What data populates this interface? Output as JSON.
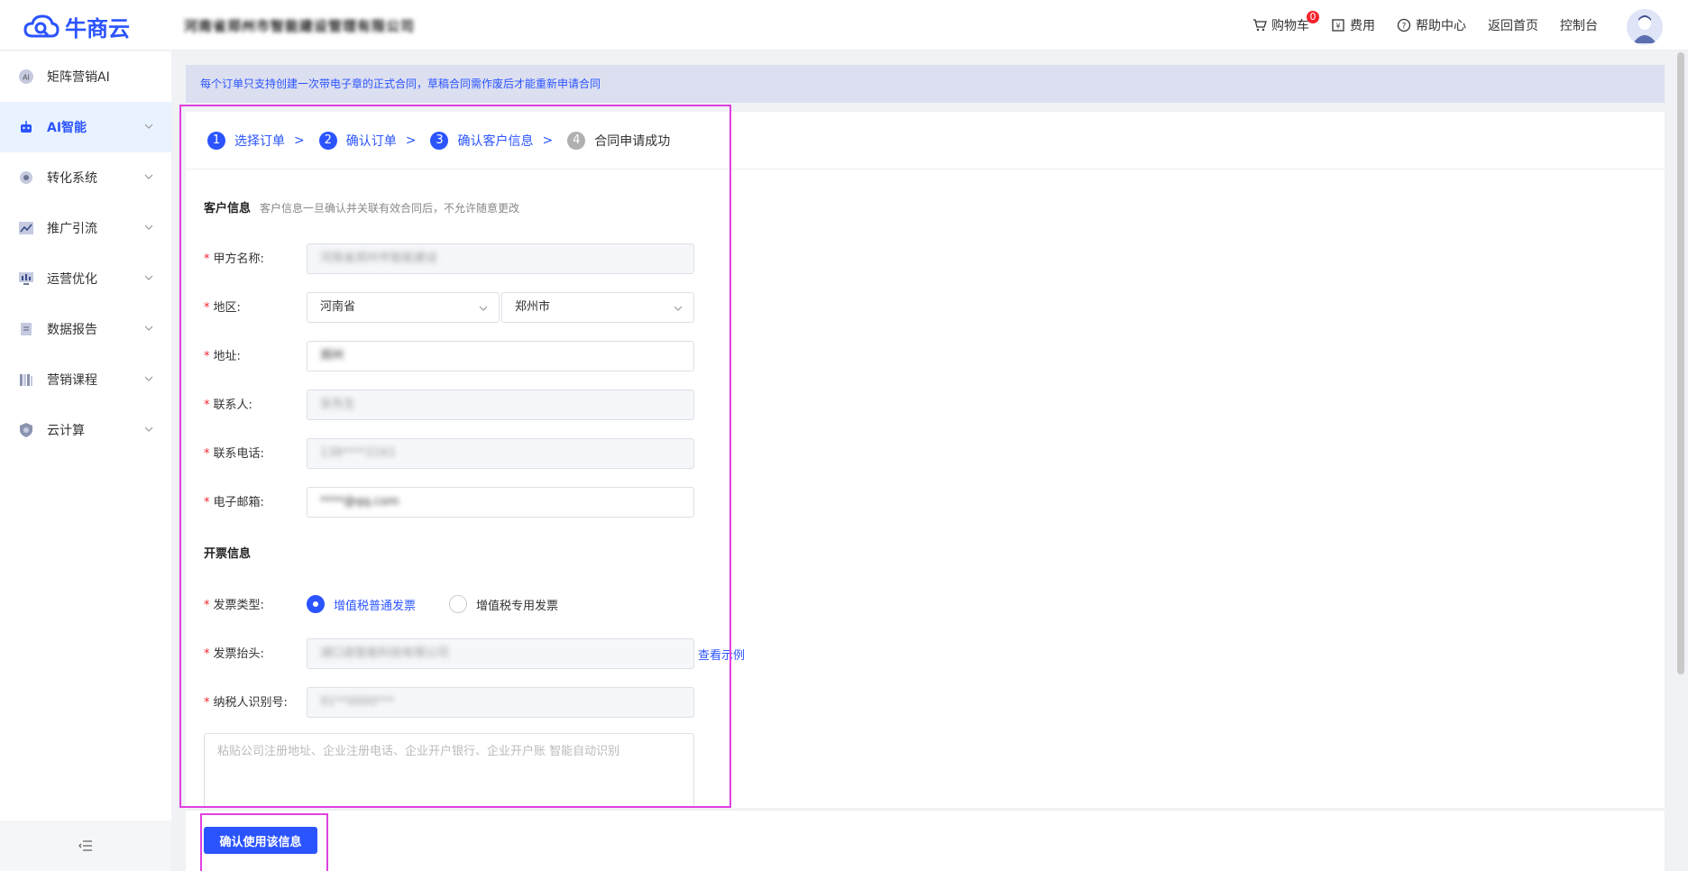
{
  "header": {
    "logo_text": "牛商云",
    "company_name": "河南省郑州市智能建设管理有限公司",
    "nav": {
      "cart": "购物车",
      "cart_count": "0",
      "fees": "费用",
      "help": "帮助中心",
      "home": "返回首页",
      "console": "控制台"
    }
  },
  "sidebar": {
    "items": [
      {
        "label": "矩阵营销AI",
        "icon": "ai-badge-icon"
      },
      {
        "label": "AI智能",
        "icon": "robot-icon"
      },
      {
        "label": "转化系统",
        "icon": "gear-icon"
      },
      {
        "label": "推广引流",
        "icon": "trend-icon"
      },
      {
        "label": "运营优化",
        "icon": "monitor-icon"
      },
      {
        "label": "数据报告",
        "icon": "report-icon"
      },
      {
        "label": "营销课程",
        "icon": "books-icon"
      },
      {
        "label": "云计算",
        "icon": "shield-icon"
      }
    ]
  },
  "notice": "每个订单只支持创建一次带电子章的正式合同，草稿合同需作废后才能重新申请合同",
  "steps": [
    {
      "num": "1",
      "label": "选择订单"
    },
    {
      "num": "2",
      "label": "确认订单"
    },
    {
      "num": "3",
      "label": "确认客户信息"
    },
    {
      "num": "4",
      "label": "合同申请成功"
    }
  ],
  "step_separator": ">",
  "customer": {
    "title": "客户信息",
    "hint": "客户信息一旦确认并关联有效合同后，不允许随意更改",
    "fields": {
      "party_a_label": "甲方名称:",
      "party_a_value": "河南省郑州市智能建设",
      "region_label": "地区:",
      "province": "河南省",
      "city": "郑州市",
      "address_label": "地址:",
      "address_value": "郑州",
      "contact_label": "联系人:",
      "contact_value": "张先生",
      "phone_label": "联系电话:",
      "phone_value": "138****2161",
      "email_label": "电子邮箱:",
      "email_value": "****@qq.com"
    }
  },
  "invoice": {
    "title": "开票信息",
    "type_label": "发票类型:",
    "options": [
      "增值税普通发票",
      "增值税专用发票"
    ],
    "selected_option": "增值税普通发票",
    "header_label": "发票抬头:",
    "header_value": "湖口县智能科技有限公司",
    "example_link": "查看示例",
    "taxid_label": "纳税人识别号:",
    "taxid_value": "91**0000***",
    "paste_placeholder": "粘贴公司注册地址、企业注册电话、企业开户银行、企业开户账 智能自动识别"
  },
  "footer": {
    "confirm_button": "确认使用该信息"
  },
  "colors": {
    "primary": "#2b54ff",
    "required": "#f5222d",
    "highlight": "#e040e0",
    "notice_bg": "#dcdff0"
  }
}
